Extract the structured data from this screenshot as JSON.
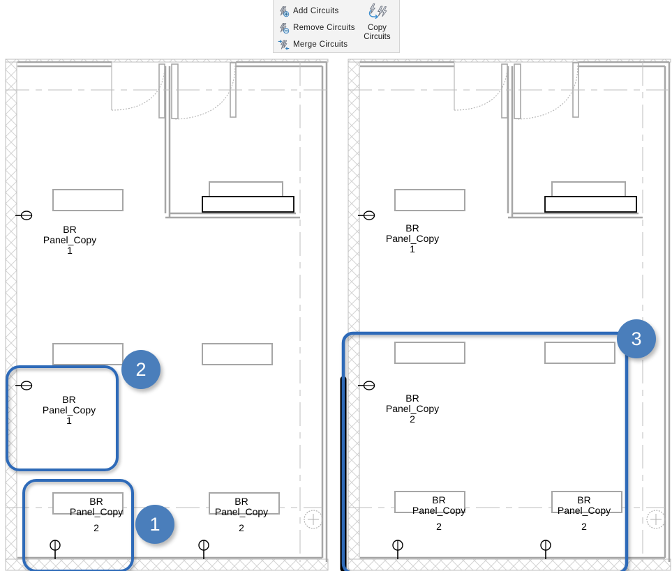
{
  "ribbon": {
    "commands": [
      {
        "label": "Add  Circuits",
        "icon": "add-circuits-icon"
      },
      {
        "label": "Remove  Circuits",
        "icon": "remove-circuits-icon"
      },
      {
        "label": "Merge  Circuits",
        "icon": "merge-circuits-icon"
      }
    ],
    "big_button": {
      "icon": "copy-circuits-icon",
      "label_line1": "Copy",
      "label_line2": "Circuits"
    }
  },
  "callouts": [
    {
      "number": "1",
      "color": "#4a7ebb"
    },
    {
      "number": "2",
      "color": "#4a7ebb"
    },
    {
      "number": "3",
      "color": "#4a7ebb"
    }
  ],
  "plans": {
    "left": {
      "room_labels": [
        {
          "line1": "BR",
          "line2": "Panel_Copy",
          "line3": "1"
        },
        {
          "line1": "BR",
          "line2": "Panel_Copy",
          "line3": "1"
        },
        {
          "line1": "BR",
          "line2": "Panel_Copy",
          "line3": "2"
        },
        {
          "line1": "BR",
          "line2": "Panel_Copy",
          "line3": "2"
        }
      ]
    },
    "right": {
      "room_labels": [
        {
          "line1": "BR",
          "line2": "Panel_Copy",
          "line3": "1"
        },
        {
          "line1": "BR",
          "line2": "Panel_Copy",
          "line3": "2"
        },
        {
          "line1": "BR",
          "line2": "Panel_Copy",
          "line3": "2"
        },
        {
          "line1": "BR",
          "line2": "Panel_Copy",
          "line3": "2"
        }
      ]
    }
  },
  "colors": {
    "highlight_stroke": "#2e6bb8",
    "callout_fill": "#4a7ebb",
    "wall": "#a6a6a6",
    "thin_line": "#bdbdbd",
    "text": "#000000"
  }
}
